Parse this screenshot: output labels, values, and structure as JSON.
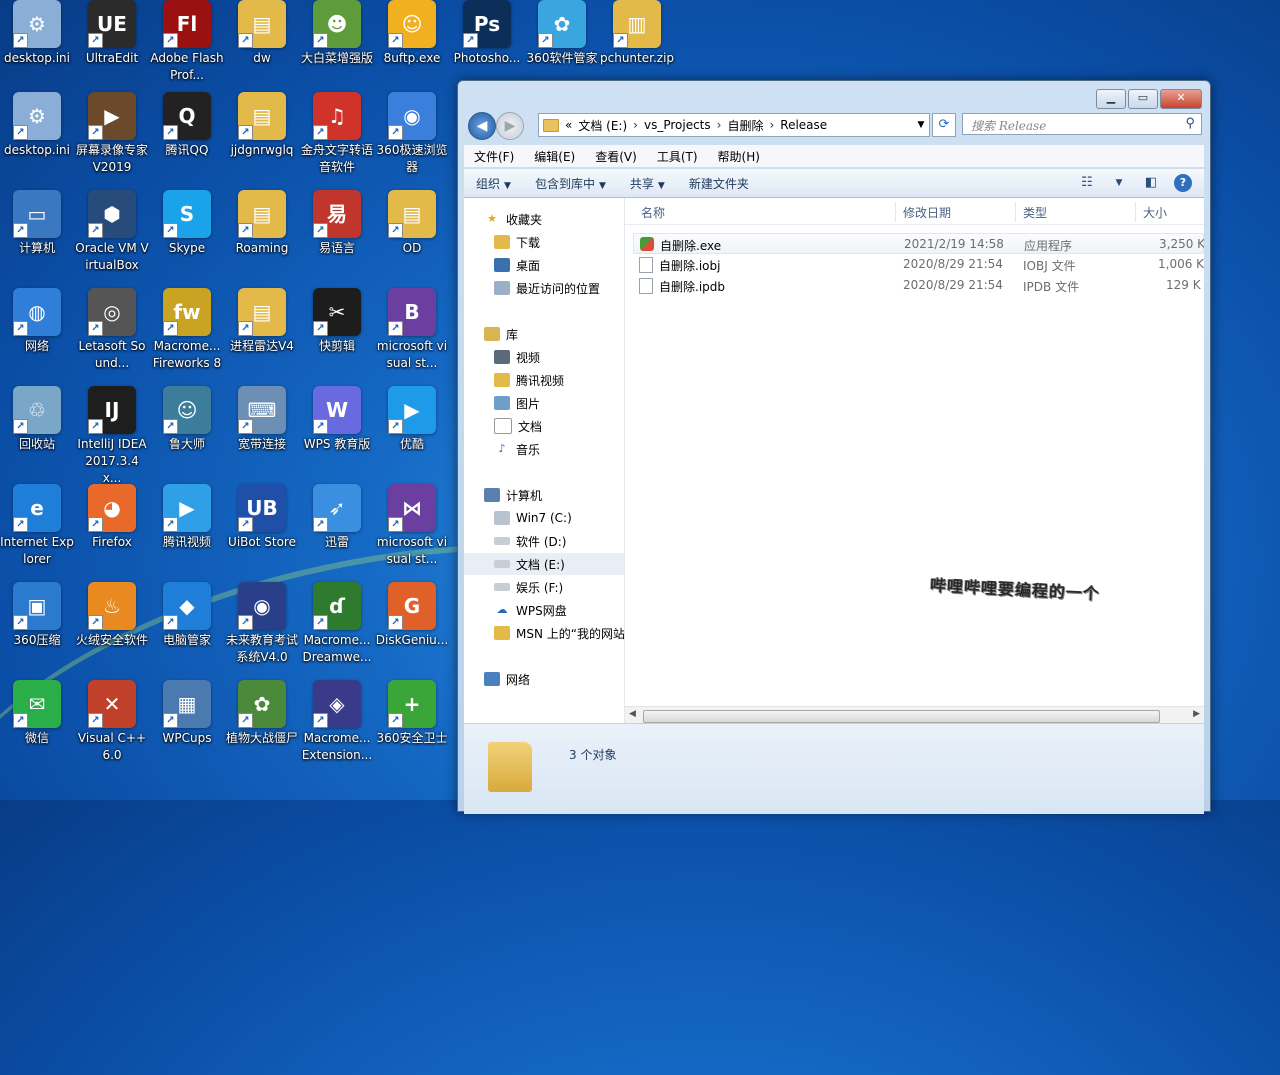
{
  "desktop": {
    "icons": [
      {
        "label": "desktop.ini",
        "glyph": "⚙",
        "color": "#8aaed6"
      },
      {
        "label": "UltraEdit",
        "glyph": "UE",
        "color": "#2b2b2b"
      },
      {
        "label": "Adobe Flash Prof...",
        "glyph": "Fl",
        "color": "#9b1111"
      },
      {
        "label": "dw",
        "glyph": "▤",
        "color": "#e3b94a"
      },
      {
        "label": "大白菜增强版",
        "glyph": "☻",
        "color": "#5e9b3a"
      },
      {
        "label": "8uftp.exe",
        "glyph": "☺",
        "color": "#f0b020"
      },
      {
        "label": "Photosho...",
        "glyph": "Ps",
        "color": "#0c2f5a"
      },
      {
        "label": "360软件管家",
        "glyph": "✿",
        "color": "#3aa6e0"
      },
      {
        "label": "pchunter.zip",
        "glyph": "▥",
        "color": "#e3b94a"
      },
      {
        "label": "desktop.ini",
        "glyph": "⚙",
        "color": "#8aaed6"
      },
      {
        "label": "屏幕录像专家V2019",
        "glyph": "▶",
        "color": "#6a4a2a"
      },
      {
        "label": "腾讯QQ",
        "glyph": "Q",
        "color": "#222222"
      },
      {
        "label": "jjdgnrwglq",
        "glyph": "▤",
        "color": "#e3b94a"
      },
      {
        "label": "金舟文字转语音软件",
        "glyph": "♫",
        "color": "#d0332a"
      },
      {
        "label": "360极速浏览器",
        "glyph": "◉",
        "color": "#3b7fdc"
      },
      {
        "label": "计算机",
        "glyph": "▭",
        "color": "#3a78c2"
      },
      {
        "label": "Oracle VM VirtualBox",
        "glyph": "⬢",
        "color": "#274b7a"
      },
      {
        "label": "Skype",
        "glyph": "S",
        "color": "#1aa3e8"
      },
      {
        "label": "Roaming",
        "glyph": "▤",
        "color": "#e3b94a"
      },
      {
        "label": "易语言",
        "glyph": "易",
        "color": "#c0362c"
      },
      {
        "label": "OD",
        "glyph": "▤",
        "color": "#e3b94a"
      },
      {
        "label": "网络",
        "glyph": "◍",
        "color": "#2f7ed8"
      },
      {
        "label": "Letasoft Sound...",
        "glyph": "◎",
        "color": "#555555"
      },
      {
        "label": "Macrome... Fireworks 8",
        "glyph": "fw",
        "color": "#c9a321"
      },
      {
        "label": "进程雷达V4",
        "glyph": "▤",
        "color": "#e3b94a"
      },
      {
        "label": "快剪辑",
        "glyph": "✂",
        "color": "#1d1d1d"
      },
      {
        "label": "microsoft visual st...",
        "glyph": "B",
        "color": "#6b3fa0"
      },
      {
        "label": "回收站",
        "glyph": "♲",
        "color": "#7aa7c7"
      },
      {
        "label": "IntelliJ IDEA 2017.3.4 x...",
        "glyph": "IJ",
        "color": "#1e1e1e"
      },
      {
        "label": "鲁大师",
        "glyph": "☺",
        "color": "#3b7d9b"
      },
      {
        "label": "宽带连接",
        "glyph": "⌨",
        "color": "#6d8fb5"
      },
      {
        "label": "WPS 教育版",
        "glyph": "W",
        "color": "#6a6ae0"
      },
      {
        "label": "优酷",
        "glyph": "▶",
        "color": "#1e9be8"
      },
      {
        "label": "Internet Explorer",
        "glyph": "e",
        "color": "#1f7ed8"
      },
      {
        "label": "Firefox",
        "glyph": "◕",
        "color": "#e8692a"
      },
      {
        "label": "腾讯视频",
        "glyph": "▶",
        "color": "#2fa0e8"
      },
      {
        "label": "UiBot Store",
        "glyph": "UB",
        "color": "#1f4fa8"
      },
      {
        "label": "迅雷",
        "glyph": "➶",
        "color": "#3a8fe0"
      },
      {
        "label": "microsoft visual st...",
        "glyph": "⋈",
        "color": "#6b3fa0"
      },
      {
        "label": "360压缩",
        "glyph": "▣",
        "color": "#2a7ad0"
      },
      {
        "label": "火绒安全软件",
        "glyph": "♨",
        "color": "#e88a20"
      },
      {
        "label": "电脑管家",
        "glyph": "◆",
        "color": "#1f7ed8"
      },
      {
        "label": "未来教育考试系统V4.0",
        "glyph": "◉",
        "color": "#2a3f8a"
      },
      {
        "label": "Macrome... Dreamwe...",
        "glyph": "ɗ",
        "color": "#2e7a2e"
      },
      {
        "label": "DiskGeniu...",
        "glyph": "G",
        "color": "#e0602a"
      },
      {
        "label": "微信",
        "glyph": "✉",
        "color": "#2aae4a"
      },
      {
        "label": "Visual C++ 6.0",
        "glyph": "✕",
        "color": "#c0402a"
      },
      {
        "label": "WPCups",
        "glyph": "▦",
        "color": "#4a7ab0"
      },
      {
        "label": "植物大战僵尸",
        "glyph": "✿",
        "color": "#4a8a3a"
      },
      {
        "label": "Macrome... Extension...",
        "glyph": "◈",
        "color": "#3a3a8a"
      },
      {
        "label": "360安全卫士",
        "glyph": "+",
        "color": "#3aa63a"
      }
    ]
  },
  "window": {
    "address": {
      "prefix": "«",
      "segments": [
        "文档 (E:)",
        "vs_Projects",
        "自删除",
        "Release"
      ],
      "separator": "›"
    },
    "search_placeholder": "搜索 Release",
    "menu": [
      "文件(F)",
      "编辑(E)",
      "查看(V)",
      "工具(T)",
      "帮助(H)"
    ],
    "toolbar": {
      "organize": "组织",
      "include": "包含到库中",
      "share": "共享",
      "new_folder": "新建文件夹"
    },
    "nav": {
      "favorites": "收藏夹",
      "downloads": "下载",
      "desktop": "桌面",
      "recent": "最近访问的位置",
      "libraries": "库",
      "videos": "视频",
      "tencent_video": "腾讯视频",
      "pictures": "图片",
      "documents": "文档",
      "music": "音乐",
      "computer": "计算机",
      "drive_c": "Win7 (C:)",
      "drive_d": "软件 (D:)",
      "drive_e": "文档 (E:)",
      "drive_f": "娱乐 (F:)",
      "wps": "WPS网盘",
      "msn": "MSN 上的“我的网站",
      "network": "网络"
    },
    "columns": {
      "name": "名称",
      "date": "修改日期",
      "type": "类型",
      "size": "大小"
    },
    "files": [
      {
        "name": "自删除.exe",
        "date": "2021/2/19 14:58",
        "type": "应用程序",
        "size": "3,250 K"
      },
      {
        "name": "自删除.iobj",
        "date": "2020/8/29 21:54",
        "type": "IOBJ 文件",
        "size": "1,006 K"
      },
      {
        "name": "自删除.ipdb",
        "date": "2020/8/29 21:54",
        "type": "IPDB 文件",
        "size": "129 K"
      }
    ],
    "status_count": "3 个对象"
  },
  "watermark": "哔哩哔哩要编程的一个"
}
